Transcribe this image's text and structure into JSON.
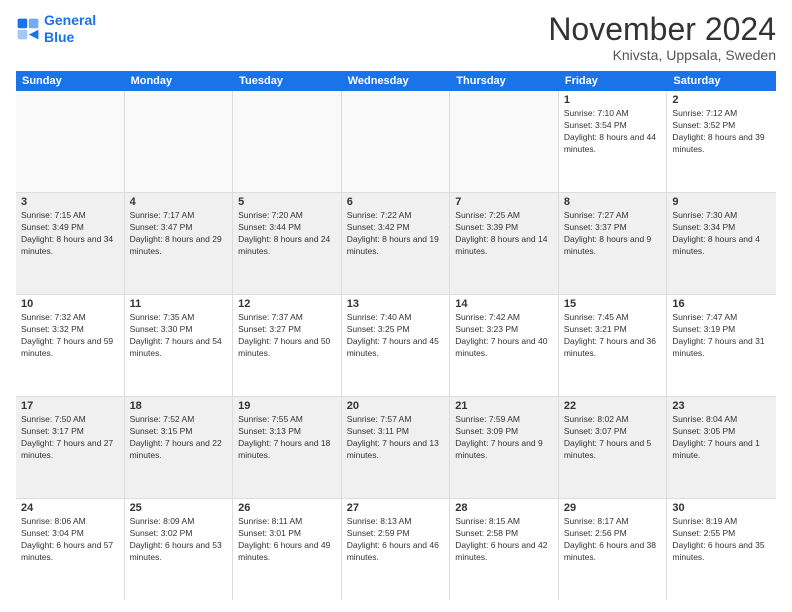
{
  "logo": {
    "line1": "General",
    "line2": "Blue"
  },
  "title": "November 2024",
  "location": "Knivsta, Uppsala, Sweden",
  "weekdays": [
    "Sunday",
    "Monday",
    "Tuesday",
    "Wednesday",
    "Thursday",
    "Friday",
    "Saturday"
  ],
  "weeks": [
    [
      {
        "day": "",
        "info": ""
      },
      {
        "day": "",
        "info": ""
      },
      {
        "day": "",
        "info": ""
      },
      {
        "day": "",
        "info": ""
      },
      {
        "day": "",
        "info": ""
      },
      {
        "day": "1",
        "info": "Sunrise: 7:10 AM\nSunset: 3:54 PM\nDaylight: 8 hours and 44 minutes."
      },
      {
        "day": "2",
        "info": "Sunrise: 7:12 AM\nSunset: 3:52 PM\nDaylight: 8 hours and 39 minutes."
      }
    ],
    [
      {
        "day": "3",
        "info": "Sunrise: 7:15 AM\nSunset: 3:49 PM\nDaylight: 8 hours and 34 minutes."
      },
      {
        "day": "4",
        "info": "Sunrise: 7:17 AM\nSunset: 3:47 PM\nDaylight: 8 hours and 29 minutes."
      },
      {
        "day": "5",
        "info": "Sunrise: 7:20 AM\nSunset: 3:44 PM\nDaylight: 8 hours and 24 minutes."
      },
      {
        "day": "6",
        "info": "Sunrise: 7:22 AM\nSunset: 3:42 PM\nDaylight: 8 hours and 19 minutes."
      },
      {
        "day": "7",
        "info": "Sunrise: 7:25 AM\nSunset: 3:39 PM\nDaylight: 8 hours and 14 minutes."
      },
      {
        "day": "8",
        "info": "Sunrise: 7:27 AM\nSunset: 3:37 PM\nDaylight: 8 hours and 9 minutes."
      },
      {
        "day": "9",
        "info": "Sunrise: 7:30 AM\nSunset: 3:34 PM\nDaylight: 8 hours and 4 minutes."
      }
    ],
    [
      {
        "day": "10",
        "info": "Sunrise: 7:32 AM\nSunset: 3:32 PM\nDaylight: 7 hours and 59 minutes."
      },
      {
        "day": "11",
        "info": "Sunrise: 7:35 AM\nSunset: 3:30 PM\nDaylight: 7 hours and 54 minutes."
      },
      {
        "day": "12",
        "info": "Sunrise: 7:37 AM\nSunset: 3:27 PM\nDaylight: 7 hours and 50 minutes."
      },
      {
        "day": "13",
        "info": "Sunrise: 7:40 AM\nSunset: 3:25 PM\nDaylight: 7 hours and 45 minutes."
      },
      {
        "day": "14",
        "info": "Sunrise: 7:42 AM\nSunset: 3:23 PM\nDaylight: 7 hours and 40 minutes."
      },
      {
        "day": "15",
        "info": "Sunrise: 7:45 AM\nSunset: 3:21 PM\nDaylight: 7 hours and 36 minutes."
      },
      {
        "day": "16",
        "info": "Sunrise: 7:47 AM\nSunset: 3:19 PM\nDaylight: 7 hours and 31 minutes."
      }
    ],
    [
      {
        "day": "17",
        "info": "Sunrise: 7:50 AM\nSunset: 3:17 PM\nDaylight: 7 hours and 27 minutes."
      },
      {
        "day": "18",
        "info": "Sunrise: 7:52 AM\nSunset: 3:15 PM\nDaylight: 7 hours and 22 minutes."
      },
      {
        "day": "19",
        "info": "Sunrise: 7:55 AM\nSunset: 3:13 PM\nDaylight: 7 hours and 18 minutes."
      },
      {
        "day": "20",
        "info": "Sunrise: 7:57 AM\nSunset: 3:11 PM\nDaylight: 7 hours and 13 minutes."
      },
      {
        "day": "21",
        "info": "Sunrise: 7:59 AM\nSunset: 3:09 PM\nDaylight: 7 hours and 9 minutes."
      },
      {
        "day": "22",
        "info": "Sunrise: 8:02 AM\nSunset: 3:07 PM\nDaylight: 7 hours and 5 minutes."
      },
      {
        "day": "23",
        "info": "Sunrise: 8:04 AM\nSunset: 3:05 PM\nDaylight: 7 hours and 1 minute."
      }
    ],
    [
      {
        "day": "24",
        "info": "Sunrise: 8:06 AM\nSunset: 3:04 PM\nDaylight: 6 hours and 57 minutes."
      },
      {
        "day": "25",
        "info": "Sunrise: 8:09 AM\nSunset: 3:02 PM\nDaylight: 6 hours and 53 minutes."
      },
      {
        "day": "26",
        "info": "Sunrise: 8:11 AM\nSunset: 3:01 PM\nDaylight: 6 hours and 49 minutes."
      },
      {
        "day": "27",
        "info": "Sunrise: 8:13 AM\nSunset: 2:59 PM\nDaylight: 6 hours and 46 minutes."
      },
      {
        "day": "28",
        "info": "Sunrise: 8:15 AM\nSunset: 2:58 PM\nDaylight: 6 hours and 42 minutes."
      },
      {
        "day": "29",
        "info": "Sunrise: 8:17 AM\nSunset: 2:56 PM\nDaylight: 6 hours and 38 minutes."
      },
      {
        "day": "30",
        "info": "Sunrise: 8:19 AM\nSunset: 2:55 PM\nDaylight: 6 hours and 35 minutes."
      }
    ]
  ]
}
